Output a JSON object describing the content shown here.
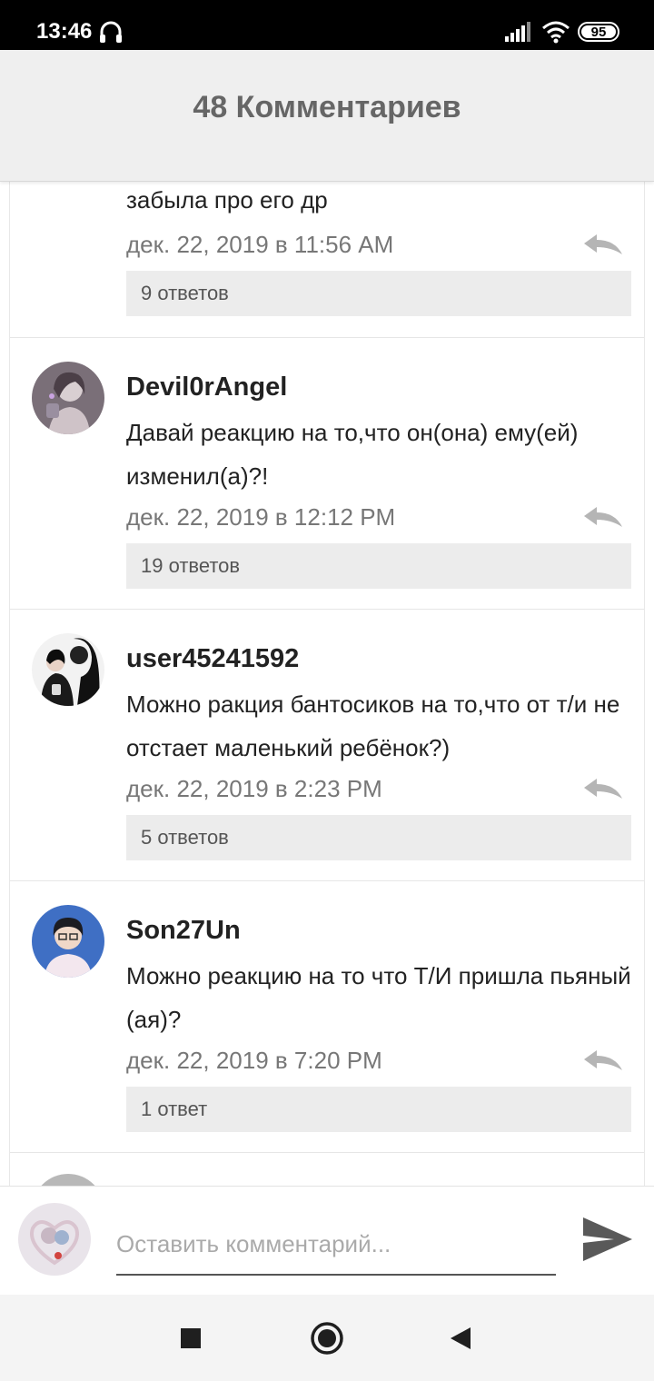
{
  "status": {
    "time": "13:46",
    "battery": "95",
    "icons": [
      "headphones-icon",
      "signal-icon",
      "wifi-icon",
      "battery-icon"
    ]
  },
  "header": {
    "title": "48 Комментариев"
  },
  "comments": [
    {
      "text": "забыла про его др",
      "date": "дек. 22, 2019 в 11:56 AM",
      "replies": "9 ответов"
    },
    {
      "author": "Devil0rAngel",
      "text": "Давай реакцию на то,что он(она) ему(ей) изменил(а)?!",
      "date": "дек. 22, 2019 в 12:12 PM",
      "replies": "19 ответов"
    },
    {
      "author": "user45241592",
      "text": "Можно ракция бантосиков на то,что от т/и  не отстает маленький ребёнок?)",
      "date": "дек. 22, 2019 в 2:23 PM",
      "replies": "5 ответов"
    },
    {
      "author": "Son27Un",
      "text": "Можно реакцию на то что Т/И пришла пьяный (ая)?",
      "date": "дек. 22, 2019 в 7:20 PM",
      "replies": "1 ответ"
    }
  ],
  "composer": {
    "placeholder": "Оставить комментарий..."
  },
  "colors": {
    "header_bg": "#efefef",
    "replies_bg": "#ececec",
    "text": "#222222",
    "muted": "#777777"
  }
}
